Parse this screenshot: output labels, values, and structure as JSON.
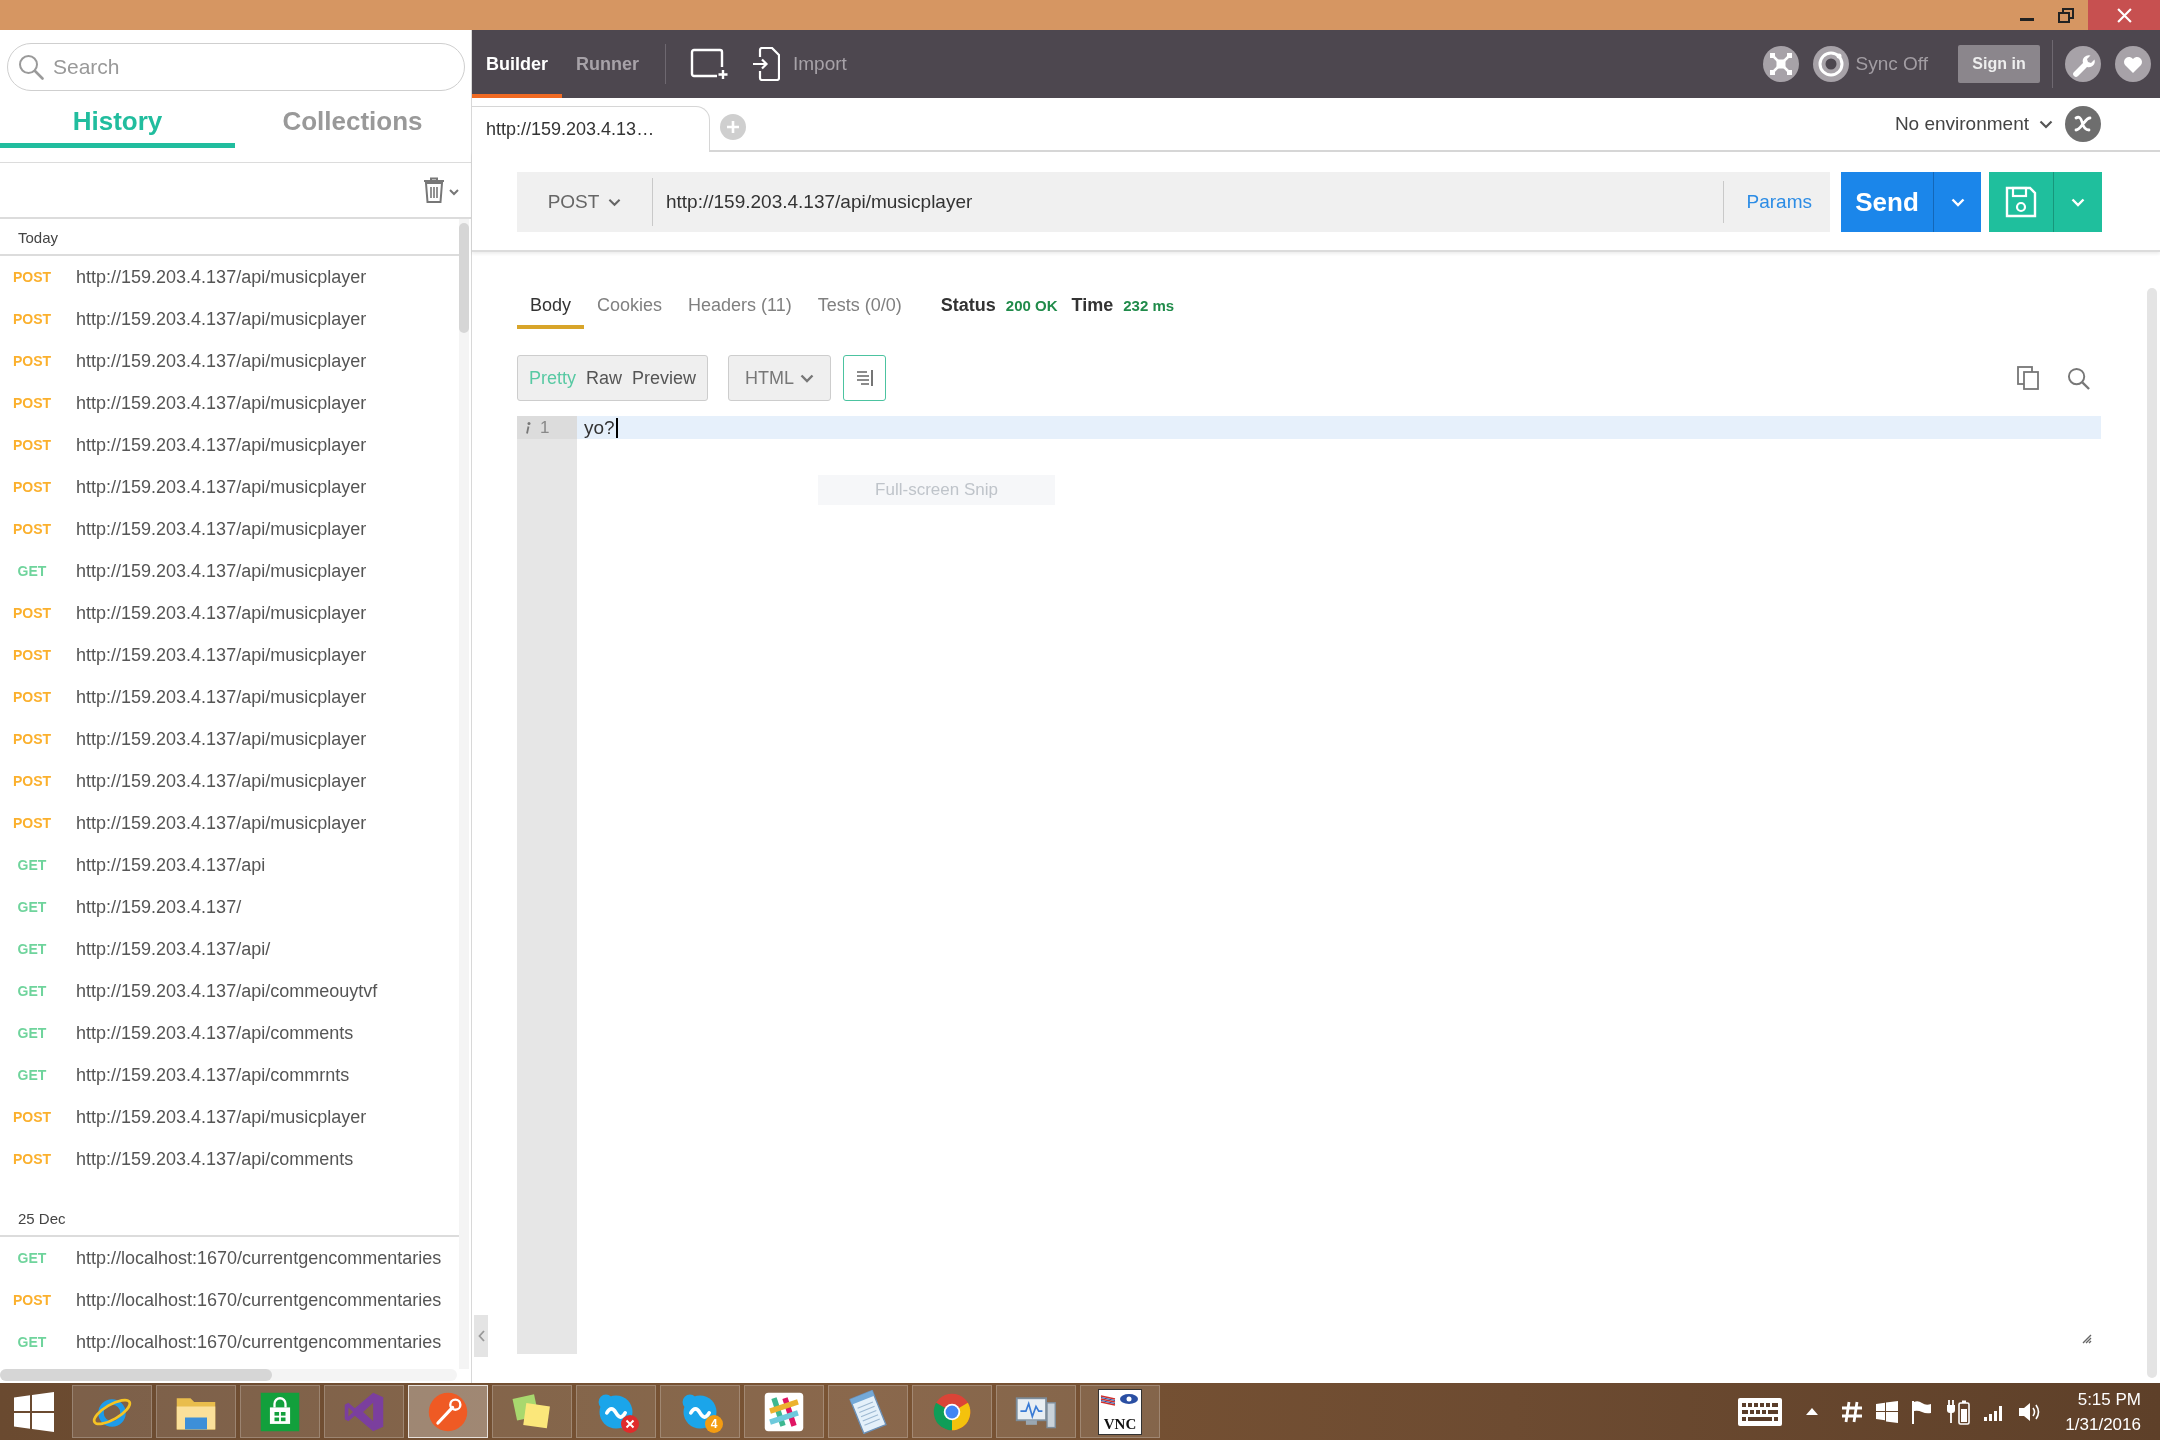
{
  "sidebar": {
    "search": {
      "placeholder": "Search"
    },
    "tabs": [
      {
        "label": "History",
        "selected": true
      },
      {
        "label": "Collections",
        "selected": false
      }
    ],
    "groups": [
      {
        "title": "Today",
        "items": [
          {
            "method": "POST",
            "color": "#fbb02d",
            "url": "http://159.203.4.137/api/musicplayer"
          },
          {
            "method": "POST",
            "color": "#fbb02d",
            "url": "http://159.203.4.137/api/musicplayer"
          },
          {
            "method": "POST",
            "color": "#fbb02d",
            "url": "http://159.203.4.137/api/musicplayer"
          },
          {
            "method": "POST",
            "color": "#fbb02d",
            "url": "http://159.203.4.137/api/musicplayer"
          },
          {
            "method": "POST",
            "color": "#fbb02d",
            "url": "http://159.203.4.137/api/musicplayer"
          },
          {
            "method": "POST",
            "color": "#fbb02d",
            "url": "http://159.203.4.137/api/musicplayer"
          },
          {
            "method": "POST",
            "color": "#fbb02d",
            "url": "http://159.203.4.137/api/musicplayer"
          },
          {
            "method": "GET",
            "color": "#6fd49c",
            "url": "http://159.203.4.137/api/musicplayer"
          },
          {
            "method": "POST",
            "color": "#fbb02d",
            "url": "http://159.203.4.137/api/musicplayer"
          },
          {
            "method": "POST",
            "color": "#fbb02d",
            "url": "http://159.203.4.137/api/musicplayer"
          },
          {
            "method": "POST",
            "color": "#fbb02d",
            "url": "http://159.203.4.137/api/musicplayer"
          },
          {
            "method": "POST",
            "color": "#fbb02d",
            "url": "http://159.203.4.137/api/musicplayer"
          },
          {
            "method": "POST",
            "color": "#fbb02d",
            "url": "http://159.203.4.137/api/musicplayer"
          },
          {
            "method": "POST",
            "color": "#fbb02d",
            "url": "http://159.203.4.137/api/musicplayer"
          },
          {
            "method": "GET",
            "color": "#6fd49c",
            "url": "http://159.203.4.137/api"
          },
          {
            "method": "GET",
            "color": "#6fd49c",
            "url": "http://159.203.4.137/"
          },
          {
            "method": "GET",
            "color": "#6fd49c",
            "url": "http://159.203.4.137/api/"
          },
          {
            "method": "GET",
            "color": "#6fd49c",
            "url": "http://159.203.4.137/api/commeouytvf"
          },
          {
            "method": "GET",
            "color": "#6fd49c",
            "url": "http://159.203.4.137/api/comments"
          },
          {
            "method": "GET",
            "color": "#6fd49c",
            "url": "http://159.203.4.137/api/commrnts"
          },
          {
            "method": "POST",
            "color": "#fbb02d",
            "url": "http://159.203.4.137/api/musicplayer"
          },
          {
            "method": "POST",
            "color": "#fbb02d",
            "url": "http://159.203.4.137/api/comments"
          }
        ]
      },
      {
        "title": "25 Dec",
        "items": [
          {
            "method": "GET",
            "color": "#6fd49c",
            "url": "http://localhost:1670/currentgencommentaries"
          },
          {
            "method": "POST",
            "color": "#fbb02d",
            "url": "http://localhost:1670/currentgencommentaries"
          },
          {
            "method": "GET",
            "color": "#6fd49c",
            "url": "http://localhost:1670/currentgencommentaries"
          }
        ]
      }
    ]
  },
  "toolbar": {
    "tabs": [
      {
        "label": "Builder",
        "selected": true
      },
      {
        "label": "Runner",
        "selected": false
      }
    ],
    "import": "Import",
    "sync": "Sync Off",
    "sign_in": "Sign in"
  },
  "request_tabs": [
    {
      "label": "http://159.203.4.13…",
      "selected": true
    }
  ],
  "environment": "No environment",
  "request": {
    "method": "POST",
    "url": "http://159.203.4.137/api/musicplayer",
    "params": "Params",
    "send": "Send"
  },
  "response": {
    "tabs": [
      {
        "label": "Body",
        "selected": true
      },
      {
        "label": "Cookies",
        "selected": false
      },
      {
        "label": "Headers (11)",
        "selected": false
      },
      {
        "label": "Tests (0/0)",
        "selected": false
      }
    ],
    "status_label": "Status",
    "status": "200 OK",
    "time_label": "Time",
    "time": "232 ms",
    "views": [
      {
        "label": "Pretty",
        "selected": true
      },
      {
        "label": "Raw",
        "selected": false
      },
      {
        "label": "Preview",
        "selected": false
      }
    ],
    "format": "HTML",
    "lines": [
      {
        "number": "1",
        "text": "yo?"
      }
    ]
  },
  "snip_hint": "Full-screen Snip",
  "taskbar": {
    "apps": [
      {
        "kind": "swoosh",
        "selected": false,
        "alert": false
      },
      {
        "kind": "folder",
        "selected": false,
        "alert": false
      },
      {
        "kind": "bag",
        "selected": false,
        "alert": false
      },
      {
        "kind": "ribbon",
        "selected": false,
        "alert": false
      },
      {
        "kind": "pen",
        "selected": true,
        "alert": false
      },
      {
        "kind": "notes",
        "selected": false,
        "alert": false
      },
      {
        "kind": "chat",
        "selected": false,
        "alert": true
      },
      {
        "kind": "chat",
        "selected": false,
        "alert": false,
        "badge": "4"
      },
      {
        "kind": "hash",
        "selected": false,
        "alert": false
      },
      {
        "kind": "notepad",
        "selected": false,
        "alert": false
      },
      {
        "kind": "wheel",
        "selected": false,
        "alert": false
      },
      {
        "kind": "monitor",
        "selected": false,
        "alert": false
      },
      {
        "kind": "tile",
        "selected": false,
        "alert": false,
        "label": "VNC"
      }
    ],
    "time": "5:15 PM",
    "date": "1/31/2016"
  }
}
